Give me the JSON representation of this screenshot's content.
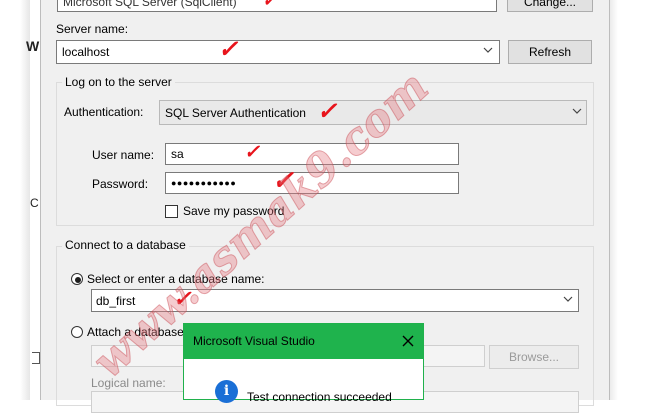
{
  "provider": {
    "value": "Microsoft SQL Server (SqlClient)",
    "change_label": "Change..."
  },
  "server": {
    "label": "Server name:",
    "value": "localhost",
    "refresh_label": "Refresh"
  },
  "logon": {
    "legend": "Log on to the server",
    "auth_label": "Authentication:",
    "auth_value": "SQL Server Authentication",
    "user_label": "User name:",
    "user_value": "sa",
    "password_label": "Password:",
    "password_mask": "●●●●●●●●●●●",
    "save_password_label": "Save my password"
  },
  "connect": {
    "legend": "Connect to a database",
    "select_db_label": "Select or enter a database name:",
    "db_value": "db_first",
    "attach_label": "Attach a database",
    "browse_label": "Browse...",
    "logical_name_label": "Logical name:"
  },
  "message_box": {
    "title": "Microsoft Visual Studio",
    "text": "Test connection succeeded",
    "close_icon": "close-icon",
    "info_icon": "info-icon",
    "info_glyph": "i"
  },
  "background_fragments": {
    "left_char": "W",
    "left_char_2": "C"
  },
  "watermark": {
    "text": "www.asmak9.com"
  },
  "colors": {
    "title_green": "#1fb34d",
    "info_blue": "#1a6fd6",
    "annotation_red": "#e8141c"
  }
}
